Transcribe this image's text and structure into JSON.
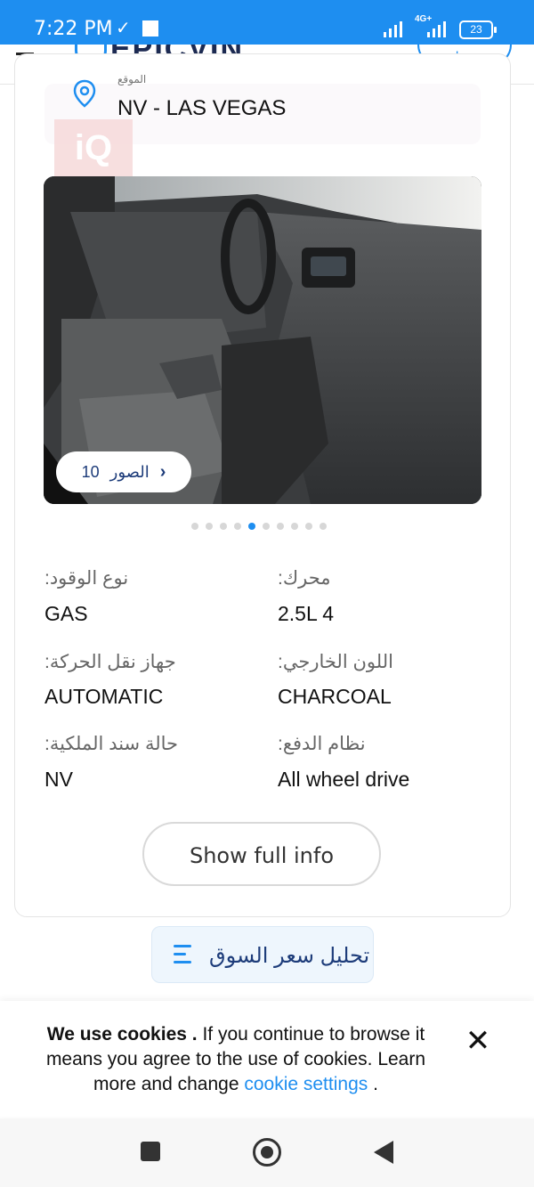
{
  "status_bar": {
    "time": "7:22 PM",
    "network": "4G+",
    "battery": "23"
  },
  "header": {
    "logo": "EPICVIN",
    "login_label": "دخول"
  },
  "location": {
    "label": "الموقع",
    "value": "NV - LAS VEGAS"
  },
  "watermark": "iQ",
  "gallery": {
    "photos_label": "الصور",
    "photos_count": "10",
    "dots_total": 10,
    "dots_active_index": 4
  },
  "specs": [
    {
      "label": "نوع الوقود:",
      "value": "GAS"
    },
    {
      "label": "محرك:",
      "value": "2.5L 4"
    },
    {
      "label": "جهاز نقل الحركة:",
      "value": "AUTOMATIC"
    },
    {
      "label": "اللون الخارجي:",
      "value": "CHARCOAL"
    },
    {
      "label": "حالة سند الملكية:",
      "value": "NV"
    },
    {
      "label": "نظام الدفع:",
      "value": "All wheel drive"
    }
  ],
  "show_full_info_label": "Show full info",
  "market_analysis_label": "تحليل سعر السوق",
  "cookie_banner": {
    "bold_text": "We use cookies .",
    "text": " If you continue to browse it means you agree to the use of cookies. Learn more and change ",
    "link_text": "cookie settings",
    "end_text": " ."
  },
  "colors": {
    "accent": "#1e8ef0",
    "status_bar": "#1e8ef0",
    "dark_blue_text": "#1d3c7a"
  }
}
